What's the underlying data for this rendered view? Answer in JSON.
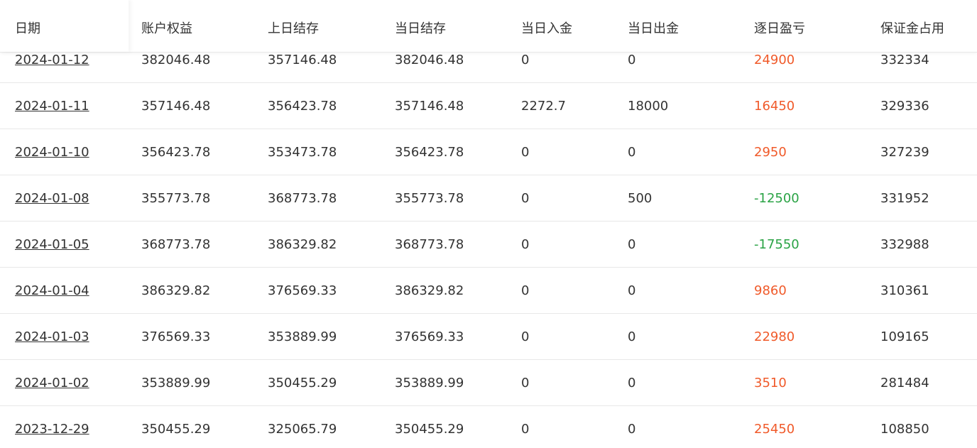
{
  "columns": [
    "日期",
    "账户权益",
    "上日结存",
    "当日结存",
    "当日入金",
    "当日出金",
    "逐日盈亏",
    "保证金占用"
  ],
  "rows": [
    {
      "date": "2024-01-12",
      "equity": "382046.48",
      "prev_balance": "357146.48",
      "balance": "382046.48",
      "deposit": "0",
      "withdraw": "0",
      "pnl": "24900",
      "pnl_sign": "pos",
      "margin": "332334"
    },
    {
      "date": "2024-01-11",
      "equity": "357146.48",
      "prev_balance": "356423.78",
      "balance": "357146.48",
      "deposit": "2272.7",
      "withdraw": "18000",
      "pnl": "16450",
      "pnl_sign": "pos",
      "margin": "329336"
    },
    {
      "date": "2024-01-10",
      "equity": "356423.78",
      "prev_balance": "353473.78",
      "balance": "356423.78",
      "deposit": "0",
      "withdraw": "0",
      "pnl": "2950",
      "pnl_sign": "pos",
      "margin": "327239"
    },
    {
      "date": "2024-01-08",
      "equity": "355773.78",
      "prev_balance": "368773.78",
      "balance": "355773.78",
      "deposit": "0",
      "withdraw": "500",
      "pnl": "-12500",
      "pnl_sign": "neg",
      "margin": "331952"
    },
    {
      "date": "2024-01-05",
      "equity": "368773.78",
      "prev_balance": "386329.82",
      "balance": "368773.78",
      "deposit": "0",
      "withdraw": "0",
      "pnl": "-17550",
      "pnl_sign": "neg",
      "margin": "332988"
    },
    {
      "date": "2024-01-04",
      "equity": "386329.82",
      "prev_balance": "376569.33",
      "balance": "386329.82",
      "deposit": "0",
      "withdraw": "0",
      "pnl": "9860",
      "pnl_sign": "pos",
      "margin": "310361"
    },
    {
      "date": "2024-01-03",
      "equity": "376569.33",
      "prev_balance": "353889.99",
      "balance": "376569.33",
      "deposit": "0",
      "withdraw": "0",
      "pnl": "22980",
      "pnl_sign": "pos",
      "margin": "109165"
    },
    {
      "date": "2024-01-02",
      "equity": "353889.99",
      "prev_balance": "350455.29",
      "balance": "353889.99",
      "deposit": "0",
      "withdraw": "0",
      "pnl": "3510",
      "pnl_sign": "pos",
      "margin": "281484"
    },
    {
      "date": "2023-12-29",
      "equity": "350455.29",
      "prev_balance": "325065.79",
      "balance": "350455.29",
      "deposit": "0",
      "withdraw": "0",
      "pnl": "25450",
      "pnl_sign": "pos",
      "margin": "108850"
    }
  ],
  "colors": {
    "profit": "#f05a2a",
    "loss": "#2aa345",
    "text": "#333333",
    "border": "#e8e8e8"
  }
}
